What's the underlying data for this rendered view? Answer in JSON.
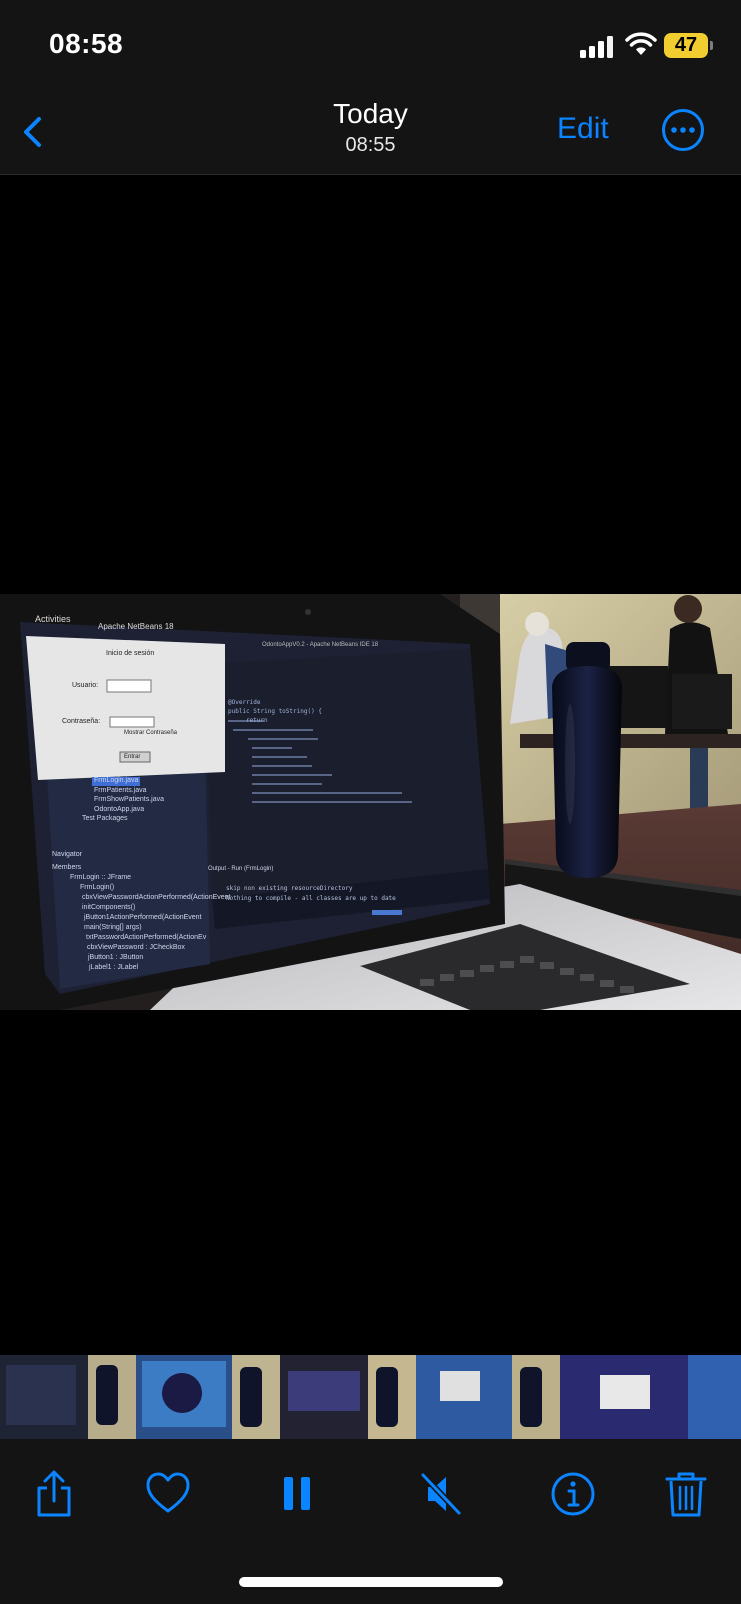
{
  "status": {
    "time": "08:58",
    "battery": "47"
  },
  "nav": {
    "title": "Today",
    "subtitle": "08:55",
    "edit_label": "Edit"
  },
  "photo": {
    "desktop_topbar": "Activities",
    "app_name": "Apache NetBeans 18",
    "window_title": "OdontoAppV0.2 - Apache NetBeans IDE 18",
    "login_dialog": {
      "title": "Inicio de sesión",
      "user_label": "Usuario:",
      "password_label": "Contraseña:",
      "show_password": "Mostrar Contraseña",
      "submit": "Entrar"
    },
    "project_files": [
      "FrmLogin.java",
      "FrmPatients.java",
      "FrmShowPatients.java",
      "OdontoApp.java",
      "Test Packages"
    ],
    "navigator": {
      "title": "Navigator",
      "section": "Members",
      "items": [
        "FrmLogin :: JFrame",
        "FrmLogin()",
        "cbxViewPasswordActionPerformed(ActionEvent",
        "initComponents()",
        "jButton1ActionPerformed(ActionEvent",
        "main(String[] args)",
        "txtPasswordActionPerformed(ActionEv",
        "cbxViewPassword : JCheckBox",
        "jButton1 : JButton",
        "jLabel1 : JLabel"
      ]
    },
    "code_lines": [
      "@Override",
      "public String toString() {",
      "",
      "return"
    ],
    "output": {
      "tab": "Output - Run (FrmLogin)",
      "lines": [
        "skip non existing resourceDirectory",
        "Nothing to compile - all classes are up to date"
      ]
    }
  },
  "colors": {
    "accent": "#0a84ff",
    "battery": "#f2cd2f",
    "bar": "#141414"
  },
  "toolbar": {
    "icons": [
      "share-icon",
      "heart-icon",
      "pause-icon",
      "mute-icon",
      "info-icon",
      "trash-icon"
    ]
  }
}
